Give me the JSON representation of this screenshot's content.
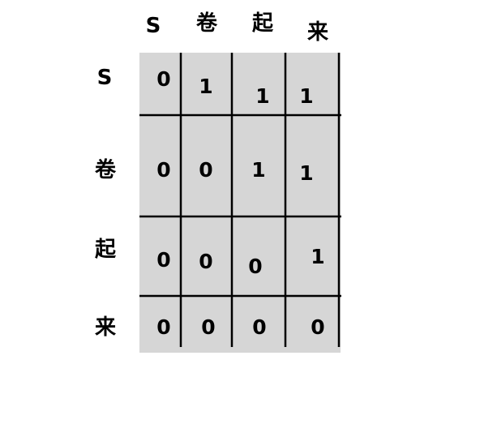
{
  "matrix": {
    "column_headers": [
      "S",
      "卷",
      "起",
      "来"
    ],
    "row_headers": [
      "S",
      "卷",
      "起",
      "来"
    ],
    "cells": [
      [
        "0",
        "1",
        "1",
        "1"
      ],
      [
        "0",
        "0",
        "1",
        "1"
      ],
      [
        "0",
        "0",
        "0",
        "1"
      ],
      [
        "0",
        "0",
        "0",
        "0"
      ]
    ]
  },
  "colors": {
    "cell_background": "#d6d6d6",
    "grid_line": "#000000",
    "text": "#000000"
  }
}
